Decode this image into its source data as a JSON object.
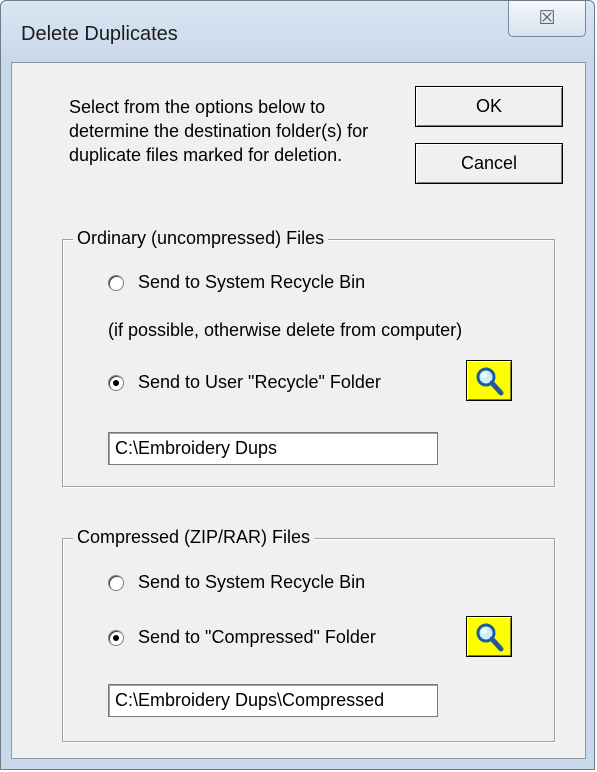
{
  "window": {
    "title": "Delete Duplicates",
    "close_glyph": "☒"
  },
  "intro_text": "Select from the options below to determine the destination folder(s) for duplicate files marked for deletion.",
  "buttons": {
    "ok_label": "OK",
    "cancel_label": "Cancel"
  },
  "ordinary_group": {
    "legend": "Ordinary (uncompressed) Files",
    "option_system": "Send to System Recycle Bin",
    "note": "(if possible, otherwise delete from computer)",
    "option_user": "Send to User \"Recycle\" Folder",
    "selected": "user",
    "folder_path": "C:\\Embroidery Dups",
    "browse_icon": "magnifier-icon"
  },
  "compressed_group": {
    "legend": "Compressed (ZIP/RAR) Files",
    "option_system": "Send to System Recycle Bin",
    "option_folder": "Send to \"Compressed\" Folder",
    "selected": "folder",
    "folder_path": "C:\\Embroidery Dups\\Compressed",
    "browse_icon": "magnifier-icon"
  },
  "colors": {
    "browse_button": "#ffff00",
    "dialog_face": "#f0f0f0"
  }
}
